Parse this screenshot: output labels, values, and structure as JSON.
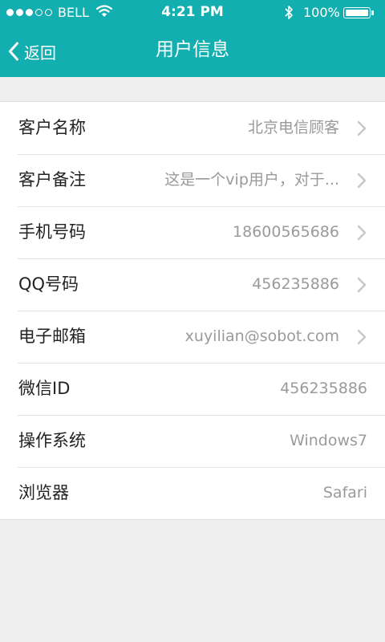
{
  "status_bar": {
    "carrier": "BELL",
    "time": "4:21 PM",
    "battery_percent": "100%",
    "signal_bars": 3,
    "signal_total": 5
  },
  "nav": {
    "back_label": "返回",
    "title": "用户信息"
  },
  "rows": [
    {
      "label": "客户名称",
      "value": "北京电信顾客",
      "arrow": true
    },
    {
      "label": "客户备注",
      "value": "这是一个vip用户，对于...",
      "arrow": true
    },
    {
      "label": "手机号码",
      "value": "18600565686",
      "arrow": true
    },
    {
      "label": "QQ号码",
      "value": "456235886",
      "arrow": true
    },
    {
      "label": "电子邮箱",
      "value": "xuyilian@sobot.com",
      "arrow": true
    },
    {
      "label": "微信ID",
      "value": "456235886",
      "arrow": false
    },
    {
      "label": "操作系统",
      "value": "Windows7",
      "arrow": false
    },
    {
      "label": "浏览器",
      "value": "Safari",
      "arrow": false
    }
  ],
  "colors": {
    "header": "#13aeb0",
    "page_background": "#efefef",
    "value_text": "#9a9a9a",
    "label_text": "#222222",
    "chevron": "#c7c7cc"
  }
}
